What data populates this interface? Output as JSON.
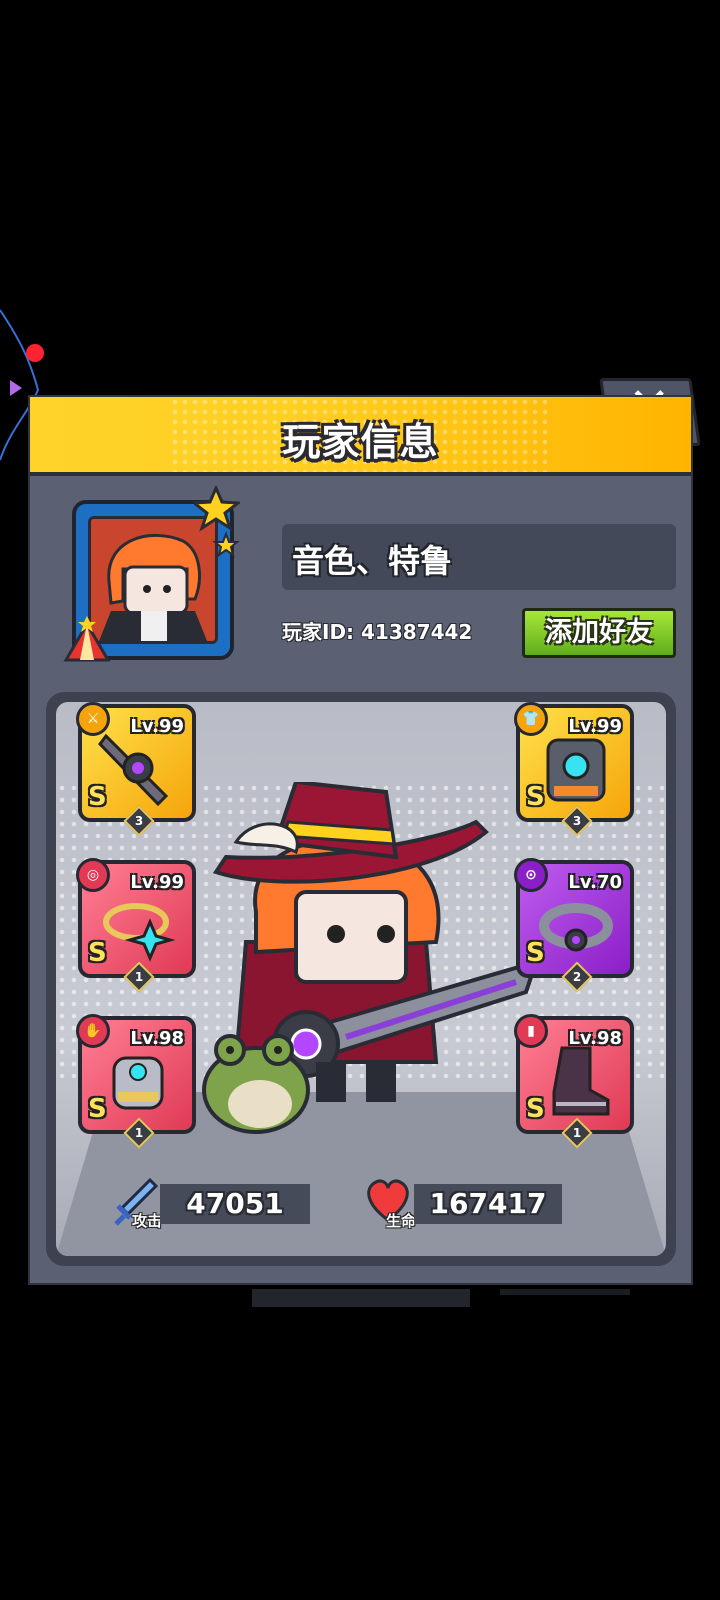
{
  "dialog": {
    "title": "玩家信息",
    "close_label": "✕"
  },
  "player": {
    "name": "音色、特鲁",
    "id_text": "玩家ID: 41387442",
    "add_friend_label": "添加好友"
  },
  "equipment": [
    {
      "slot": "weapon",
      "icon": "sword-icon",
      "level": "Lv.99",
      "grade": "S",
      "stars": "3",
      "rarity": "gold"
    },
    {
      "slot": "armor",
      "icon": "shirt-icon",
      "level": "Lv.99",
      "grade": "S",
      "stars": "3",
      "rarity": "gold"
    },
    {
      "slot": "necklace",
      "icon": "necklace-icon",
      "level": "Lv.99",
      "grade": "S",
      "stars": "1",
      "rarity": "red"
    },
    {
      "slot": "belt",
      "icon": "belt-icon",
      "level": "Lv.70",
      "grade": "S",
      "stars": "2",
      "rarity": "purple"
    },
    {
      "slot": "gloves",
      "icon": "glove-icon",
      "level": "Lv.98",
      "grade": "S",
      "stars": "1",
      "rarity": "red"
    },
    {
      "slot": "boots",
      "icon": "boot-icon",
      "level": "Lv.98",
      "grade": "S",
      "stars": "1",
      "rarity": "red"
    }
  ],
  "stats": {
    "attack_label": "攻击",
    "attack_value": "47051",
    "hp_label": "生命",
    "hp_value": "167417"
  },
  "colors": {
    "header_gold": "#ffcf22",
    "panel_gray": "#5b6172",
    "add_friend_green": "#7cc82a",
    "rarity_gold": "#f5b51b",
    "rarity_red": "#ef5a72",
    "rarity_purple": "#a43ee0"
  }
}
